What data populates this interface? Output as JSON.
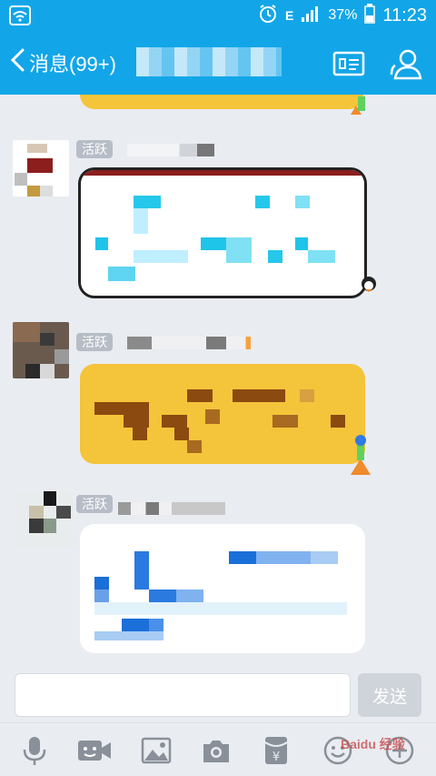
{
  "status_bar": {
    "network": "E",
    "battery": "37%",
    "time": "11:23"
  },
  "header": {
    "back_label": "消息(99+)"
  },
  "messages": [
    {
      "badge": "活跃"
    },
    {
      "badge": "活跃"
    },
    {
      "badge": "活跃"
    }
  ],
  "composer": {
    "placeholder": "",
    "send_label": "发送"
  },
  "toolbar": {
    "tools": [
      "microphone-icon",
      "emoji-icon",
      "image-icon",
      "camera-icon",
      "red-packet-icon",
      "smiley-icon",
      "plus-icon"
    ]
  },
  "watermark": "Baidu 经验",
  "colors": {
    "brand": "#12a6e8",
    "bubble_yellow": "#f4c43a",
    "background": "#e9ecf1"
  }
}
